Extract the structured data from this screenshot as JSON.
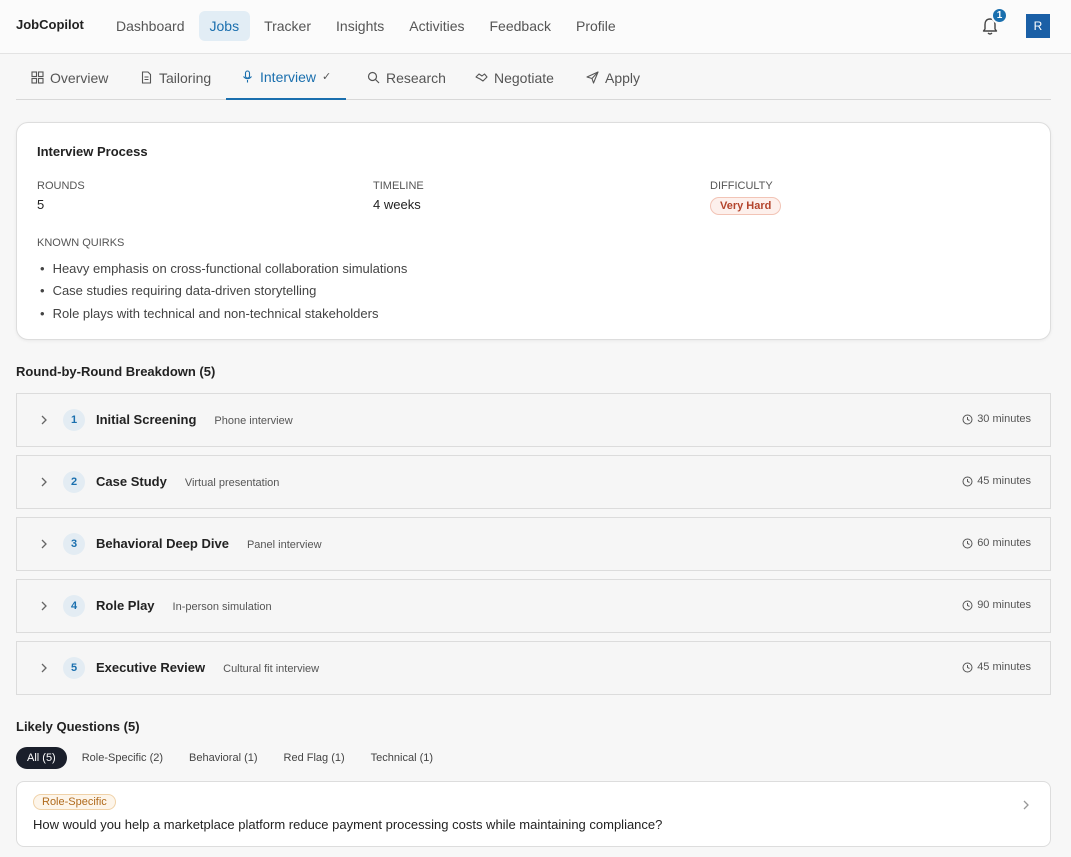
{
  "app": {
    "brand": "JobCopilot",
    "nav": [
      "Dashboard",
      "Jobs",
      "Tracker",
      "Insights",
      "Activities",
      "Feedback",
      "Profile"
    ],
    "active_nav": "Jobs",
    "notification_count": "1",
    "avatar_initial": "R"
  },
  "tabs": [
    {
      "label": "Overview",
      "icon": "grid-icon"
    },
    {
      "label": "Tailoring",
      "icon": "document-icon"
    },
    {
      "label": "Interview",
      "icon": "microphone-icon",
      "active": true,
      "check": "✓"
    },
    {
      "label": "Research",
      "icon": "search-icon"
    },
    {
      "label": "Negotiate",
      "icon": "handshake-icon"
    },
    {
      "label": "Apply",
      "icon": "send-icon"
    }
  ],
  "process": {
    "title": "Interview Process",
    "rounds_label": "ROUNDS",
    "rounds": "5",
    "timeline_label": "TIMELINE",
    "timeline": "4 weeks",
    "difficulty_label": "DIFFICULTY",
    "difficulty": "Very Hard",
    "quirks_label": "KNOWN QUIRKS",
    "quirks": [
      "Heavy emphasis on cross-functional collaboration simulations",
      "Case studies requiring data-driven storytelling",
      "Role plays with technical and non-technical stakeholders"
    ]
  },
  "breakdown": {
    "title": "Round-by-Round Breakdown (5)",
    "rounds": [
      {
        "num": "1",
        "title": "Initial Screening",
        "type": "Phone interview",
        "duration": "30 minutes"
      },
      {
        "num": "2",
        "title": "Case Study",
        "type": "Virtual presentation",
        "duration": "45 minutes"
      },
      {
        "num": "3",
        "title": "Behavioral Deep Dive",
        "type": "Panel interview",
        "duration": "60 minutes"
      },
      {
        "num": "4",
        "title": "Role Play",
        "type": "In-person simulation",
        "duration": "90 minutes"
      },
      {
        "num": "5",
        "title": "Executive Review",
        "type": "Cultural fit interview",
        "duration": "45 minutes"
      }
    ]
  },
  "questions": {
    "title": "Likely Questions (5)",
    "filters": [
      "All (5)",
      "Role-Specific (2)",
      "Behavioral (1)",
      "Red Flag (1)",
      "Technical (1)"
    ],
    "active_filter": "All (5)",
    "items": [
      {
        "tag": "Role-Specific",
        "text": "How would you help a marketplace platform reduce payment processing costs while maintaining compliance?"
      }
    ]
  },
  "colors": {
    "accent": "#1a6fae",
    "difficulty_text": "#b4442c",
    "tag_text": "#b06a1c"
  }
}
